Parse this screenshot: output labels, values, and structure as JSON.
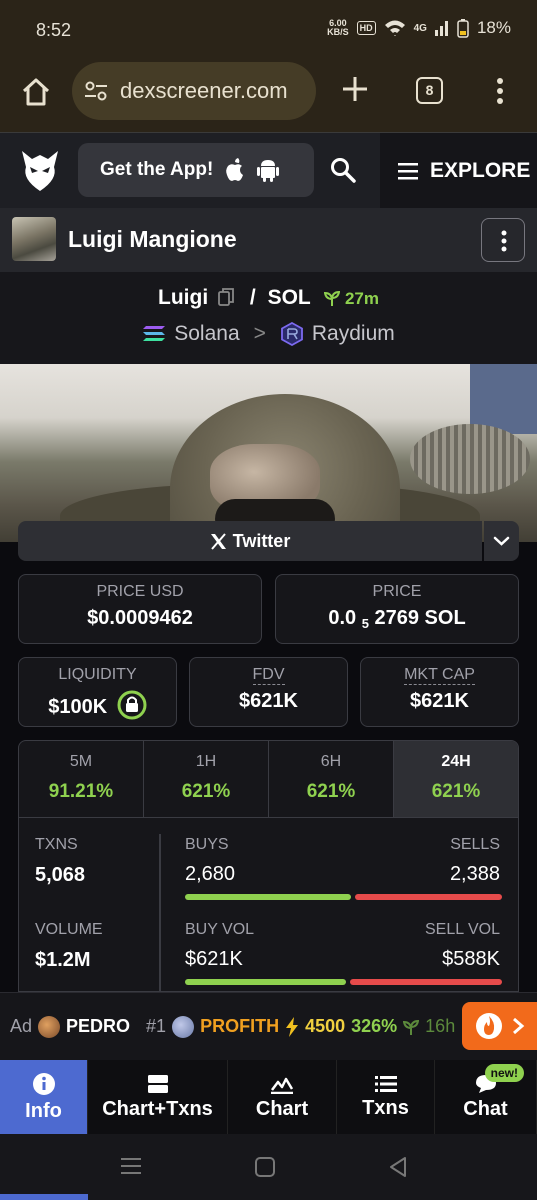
{
  "status_bar": {
    "time": "8:52",
    "net_speed_value": "6.00",
    "net_speed_unit": "KB/S",
    "hd": "HD",
    "signal": "4G",
    "battery": "18%"
  },
  "browser": {
    "url": "dexscreener.com",
    "tab_count": "8"
  },
  "site_header": {
    "get_app_label": "Get the App!",
    "explore_label": "EXPLORE"
  },
  "token": {
    "name": "Luigi Mangione",
    "base": "Luigi",
    "separator": "/",
    "quote": "SOL",
    "age": "27m",
    "chain": "Solana",
    "chevron": ">",
    "dex": "Raydium"
  },
  "twitter_label": "Twitter",
  "stats": {
    "price_usd_label": "PRICE USD",
    "price_usd": "$0.0009462",
    "price_label": "PRICE",
    "price_prefix": "0.0",
    "price_sub": "5",
    "price_rest": "2769 SOL",
    "liquidity_label": "LIQUIDITY",
    "liquidity": "$100K",
    "fdv_label": "FDV",
    "fdv": "$621K",
    "mktcap_label": "MKT CAP",
    "mktcap": "$621K"
  },
  "periods": [
    {
      "label": "5M",
      "change": "91.21%"
    },
    {
      "label": "1H",
      "change": "621%"
    },
    {
      "label": "6H",
      "change": "621%"
    },
    {
      "label": "24H",
      "change": "621%"
    }
  ],
  "txns": {
    "txns_label": "TXNS",
    "txns": "5,068",
    "buys_label": "BUYS",
    "buys": "2,680",
    "sells_label": "SELLS",
    "sells": "2,388",
    "volume_label": "VOLUME",
    "volume": "$1.2M",
    "buy_vol_label": "BUY VOL",
    "buy_vol": "$621K",
    "sell_vol_label": "SELL VOL",
    "sell_vol": "$588K",
    "buys_ratio": 0.529,
    "buy_vol_ratio": 0.514
  },
  "ad_strip": {
    "ad_label": "Ad",
    "ad_ticker": "PEDRO",
    "rank": "#1",
    "trend_ticker": "PROFITH",
    "trend_value": "4500",
    "trend_pct": "326%",
    "trend_age": "16h"
  },
  "bottom_nav": [
    {
      "label": "Info"
    },
    {
      "label": "Chart+Txns"
    },
    {
      "label": "Chart"
    },
    {
      "label": "Txns"
    },
    {
      "label": "Chat"
    }
  ],
  "chat_badge": "new!",
  "colors": {
    "accent_green": "#8fd14f",
    "sell_red": "#e64b4b",
    "nav_active": "#4d6ad0",
    "hot_orange": "#f26a1b"
  }
}
